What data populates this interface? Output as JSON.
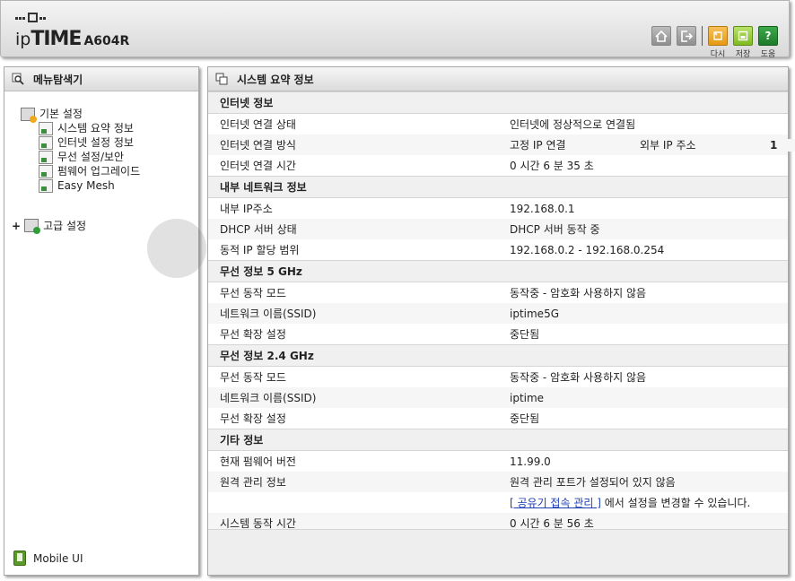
{
  "header": {
    "logo_ip": "ip",
    "logo_time": "TIME",
    "logo_model": "A604R",
    "buttons": [
      {
        "name": "home-icon"
      },
      {
        "name": "logout-icon"
      },
      {
        "label": "다시",
        "name": "refresh-icon",
        "color": "#e9a21a"
      },
      {
        "label": "저장",
        "name": "save-icon",
        "color": "#86c02b"
      },
      {
        "label": "도움",
        "name": "help-icon",
        "color": "#2a9a3a"
      }
    ]
  },
  "sidebar": {
    "title": "메뉴탐색기",
    "basic": {
      "label": "기본 설정",
      "items": [
        {
          "label": "시스템 요약 정보"
        },
        {
          "label": "인터넷 설정 정보"
        },
        {
          "label": "무선 설정/보안"
        },
        {
          "label": "펌웨어 업그레이드"
        },
        {
          "label": "Easy Mesh"
        }
      ]
    },
    "advanced": {
      "label": "고급 설정",
      "expander": "+"
    },
    "mobile_label": "Mobile UI"
  },
  "main": {
    "title": "시스템 요약 정보",
    "internet": {
      "title": "인터넷 정보",
      "status_label": "인터넷 연결 상태",
      "status_value": "인터넷에 정상적으로 연결됨",
      "method_label": "인터넷 연결 방식",
      "method_value": "고정 IP 연결",
      "ext_ip_label": "외부 IP 주소",
      "ext_ip_value": "1",
      "time_label": "인터넷 연결 시간",
      "time_value": "0 시간 6 분 35 초"
    },
    "lan": {
      "title": "내부 네트워크 정보",
      "ip_label": "내부 IP주소",
      "ip_value": "192.168.0.1",
      "dhcp_label": "DHCP 서버 상태",
      "dhcp_value": "DHCP 서버 동작 중",
      "range_label": "동적 IP 할당 범위",
      "range_value": "192.168.0.2 -  192.168.0.254"
    },
    "wifi5": {
      "title": "무선 정보 5 GHz",
      "mode_label": "무선 동작 모드",
      "mode_value": "동작중 - 암호화 사용하지 않음",
      "ssid_label": "네트워크 이름(SSID)",
      "ssid_value": "iptime5G",
      "ext_label": "무선 확장 설정",
      "ext_value": "중단됨"
    },
    "wifi24": {
      "title": "무선 정보 2.4 GHz",
      "mode_label": "무선 동작 모드",
      "mode_value": "동작중 - 암호화 사용하지 않음",
      "ssid_label": "네트워크 이름(SSID)",
      "ssid_value": "iptime",
      "ext_label": "무선 확장 설정",
      "ext_value": "중단됨"
    },
    "etc": {
      "title": "기타 정보",
      "fw_label": "현재 펌웨어 버전",
      "fw_value": "11.99.0",
      "remote_label": "원격 관리 정보",
      "remote_value": "원격 관리 포트가 설정되어 있지 않음",
      "remote_link": "[ 공유기 접속 관리 ]",
      "remote_link_suffix": " 에서 설정을 변경할 수 있습니다.",
      "uptime_label": "시스템 동작 시간",
      "uptime_value": "0 시간 6 분 56 초"
    }
  }
}
